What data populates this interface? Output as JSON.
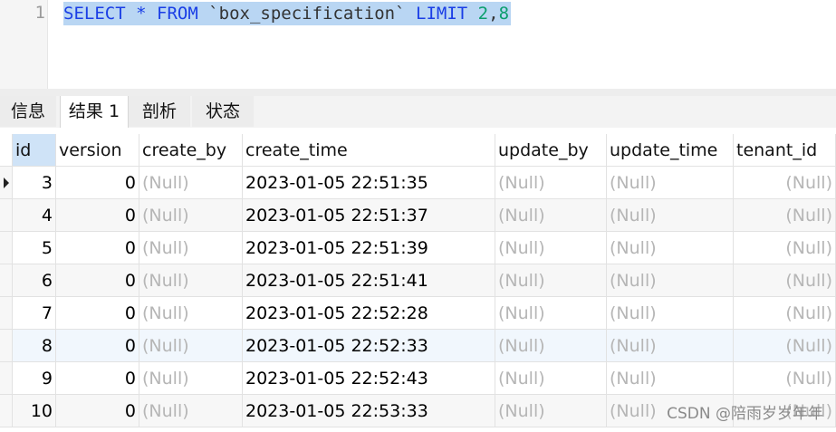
{
  "editor": {
    "line_number": "1",
    "sql": {
      "select": "SELECT",
      "star": "*",
      "from": "FROM",
      "table": "`box_specification`",
      "limit": "LIMIT",
      "offset": "2",
      "comma": ",",
      "count": "8"
    }
  },
  "tabs": [
    "信息",
    "结果 1",
    "剖析",
    "状态"
  ],
  "table": {
    "columns": [
      "id",
      "version",
      "create_by",
      "create_time",
      "update_by",
      "update_time",
      "tenant_id"
    ],
    "rows": [
      [
        "3",
        "0",
        "(Null)",
        "2023-01-05 22:51:35",
        "(Null)",
        "(Null)",
        "(Null)"
      ],
      [
        "4",
        "0",
        "(Null)",
        "2023-01-05 22:51:37",
        "(Null)",
        "(Null)",
        "(Null)"
      ],
      [
        "5",
        "0",
        "(Null)",
        "2023-01-05 22:51:39",
        "(Null)",
        "(Null)",
        "(Null)"
      ],
      [
        "6",
        "0",
        "(Null)",
        "2023-01-05 22:51:41",
        "(Null)",
        "(Null)",
        "(Null)"
      ],
      [
        "7",
        "0",
        "(Null)",
        "2023-01-05 22:52:28",
        "(Null)",
        "(Null)",
        "(Null)"
      ],
      [
        "8",
        "0",
        "(Null)",
        "2023-01-05 22:52:33",
        "(Null)",
        "(Null)",
        "(Null)"
      ],
      [
        "9",
        "0",
        "(Null)",
        "2023-01-05 22:52:43",
        "(Null)",
        "(Null)",
        "(Null)"
      ],
      [
        "10",
        "0",
        "(Null)",
        "2023-01-05 22:53:33",
        "(Null)",
        "(Null)",
        "(Null)"
      ]
    ]
  },
  "watermark": "CSDN @陪雨岁岁年年"
}
